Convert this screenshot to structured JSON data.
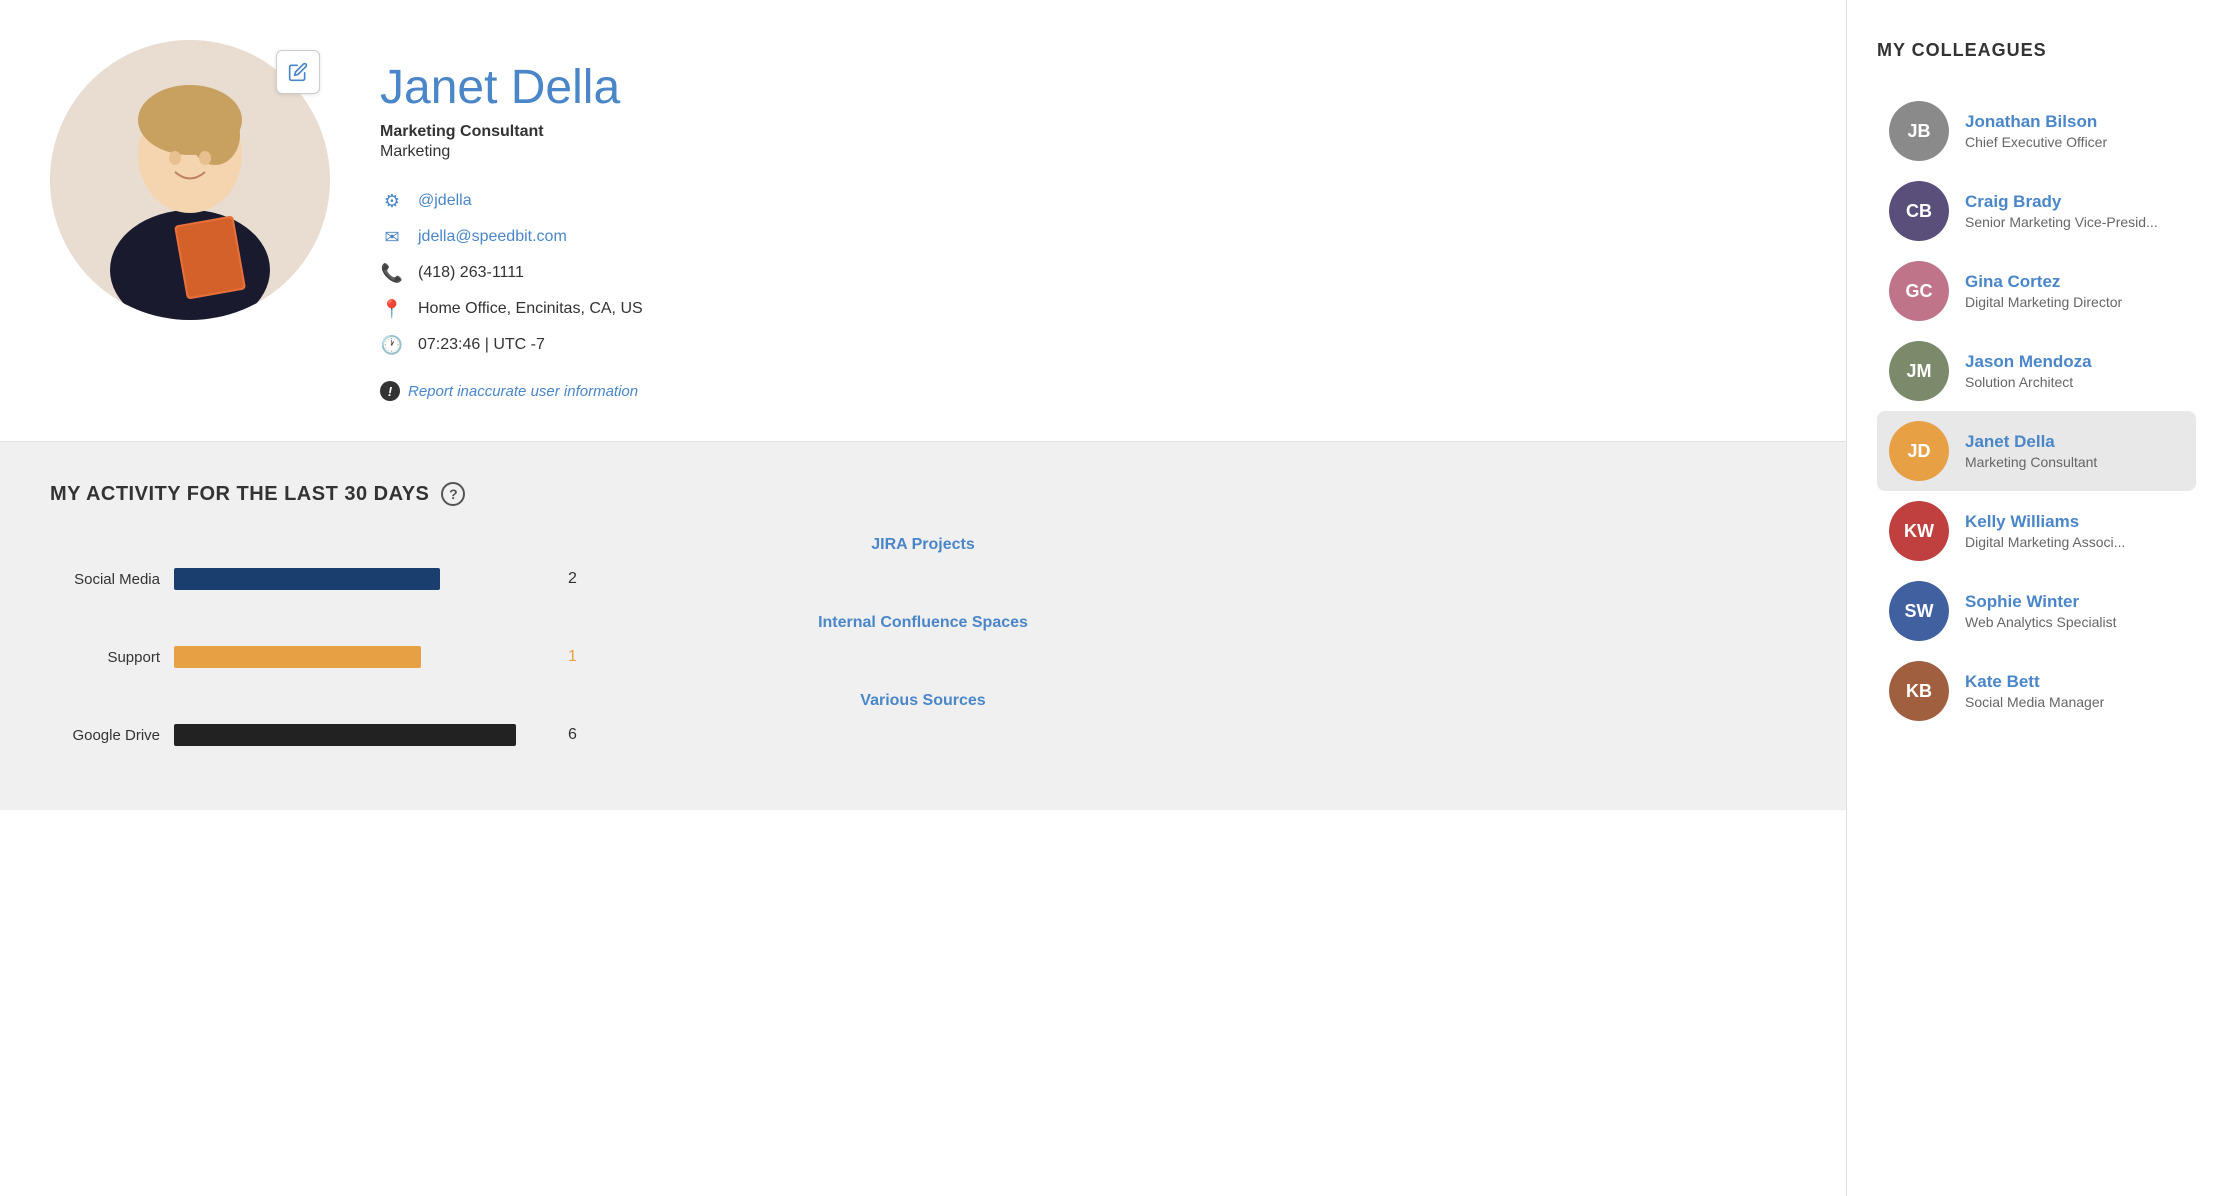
{
  "profile": {
    "name": "Janet Della",
    "title": "Marketing Consultant",
    "department": "Marketing",
    "username": "@jdella",
    "email": "jdella@speedbit.com",
    "phone": "(418) 263-1111",
    "location": "Home Office, Encinitas, CA, US",
    "time": "07:23:46 | UTC -7",
    "report_link": "Report inaccurate user information",
    "edit_label": "Edit"
  },
  "activity": {
    "section_title": "MY ACTIVITY FOR THE LAST 30 DAYS",
    "help_icon": "?",
    "groups": [
      {
        "title": "JIRA Projects",
        "bars": [
          {
            "label": "Social Media",
            "value": 2,
            "color": "blue",
            "pct": 70
          }
        ]
      },
      {
        "title": "Internal Confluence Spaces",
        "bars": [
          {
            "label": "Support",
            "value": 1,
            "color": "orange",
            "pct": 65
          }
        ]
      },
      {
        "title": "Various Sources",
        "bars": [
          {
            "label": "Google Drive",
            "value": 6,
            "color": "black",
            "pct": 90
          }
        ]
      }
    ]
  },
  "sidebar": {
    "title": "MY COLLEAGUES",
    "colleagues": [
      {
        "name": "Jonathan Bilson",
        "role": "Chief Executive Officer",
        "avatar_color": "#8a8a8a",
        "initials": "JB",
        "active": false
      },
      {
        "name": "Craig Brady",
        "role": "Senior Marketing Vice-Presid...",
        "avatar_color": "#5a4e7a",
        "initials": "CB",
        "active": false
      },
      {
        "name": "Gina Cortez",
        "role": "Digital Marketing Director",
        "avatar_color": "#c0748a",
        "initials": "GC",
        "active": false
      },
      {
        "name": "Jason Mendoza",
        "role": "Solution Architect",
        "avatar_color": "#7a8a6a",
        "initials": "JM",
        "active": false
      },
      {
        "name": "Janet Della",
        "role": "Marketing Consultant",
        "avatar_color": "#e8a045",
        "initials": "JD",
        "active": true
      },
      {
        "name": "Kelly Williams",
        "role": "Digital Marketing Associ...",
        "avatar_color": "#c04040",
        "initials": "KW",
        "active": false
      },
      {
        "name": "Sophie Winter",
        "role": "Web Analytics Specialist",
        "avatar_color": "#4060a0",
        "initials": "SW",
        "active": false
      },
      {
        "name": "Kate Bett",
        "role": "Social Media Manager",
        "avatar_color": "#a06040",
        "initials": "KB",
        "active": false
      }
    ]
  }
}
